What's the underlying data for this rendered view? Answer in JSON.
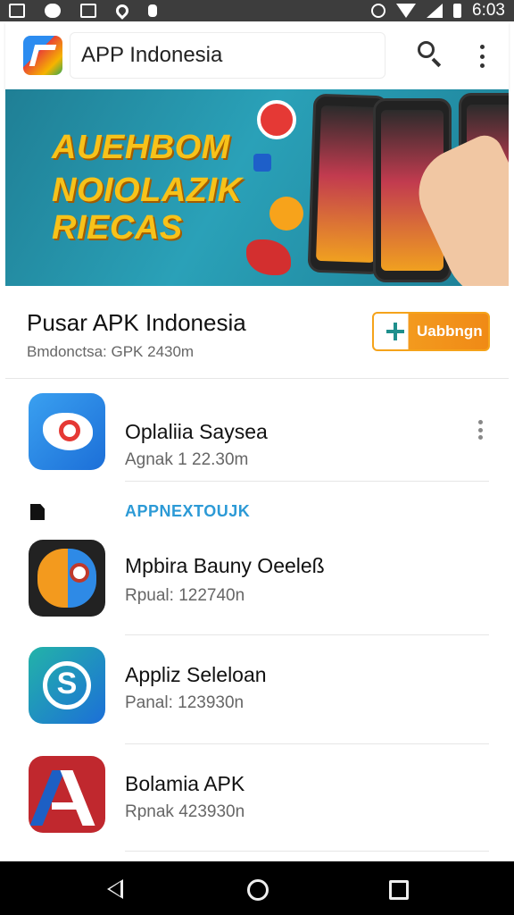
{
  "status_bar": {
    "time": "6:03",
    "left_icons": [
      "image-icon",
      "cloud-icon",
      "app-icon",
      "location-icon",
      "usb-icon"
    ],
    "right_icons": [
      "alarm-icon",
      "wifi-icon",
      "signal-icon",
      "battery-icon"
    ]
  },
  "app_bar": {
    "title": "APP Indonesia",
    "logo_icon": "app-indonesia-logo",
    "search_icon": "search-icon",
    "more_icon": "more-vert-icon"
  },
  "banner": {
    "line1": "AUEHBOM",
    "line2": "NOIOLAZIK",
    "line3": "RIECAS",
    "accent": "#f7c21a"
  },
  "developer": {
    "title": "Pusar APK Indonesia",
    "subtitle": "Bmdonctsa: GPK 2430m",
    "install_label": "Uabbngn",
    "install_color": "#f39a1e"
  },
  "apps": [
    {
      "name": "Oplaliia Saysea",
      "size": "Agnak 1 22.30m",
      "icon": "camera-icon"
    },
    {
      "name": "Mpbira Bauny Oeeleß",
      "size": "Rpual: 122740n",
      "icon": "mask-icon"
    },
    {
      "name": "Appliz Seleloan",
      "size": "Panal: 123930n",
      "icon": "sync-icon"
    },
    {
      "name": "Bolamia APK",
      "size": "Rpnak 423930n",
      "icon": "letter-a-icon"
    }
  ],
  "section": {
    "label": "APPNEXTOUJK",
    "icon": "document-icon",
    "label_color": "#2c9ad6"
  },
  "nav": {
    "back_icon": "back-icon",
    "home_icon": "home-icon",
    "recent_icon": "recent-apps-icon"
  }
}
